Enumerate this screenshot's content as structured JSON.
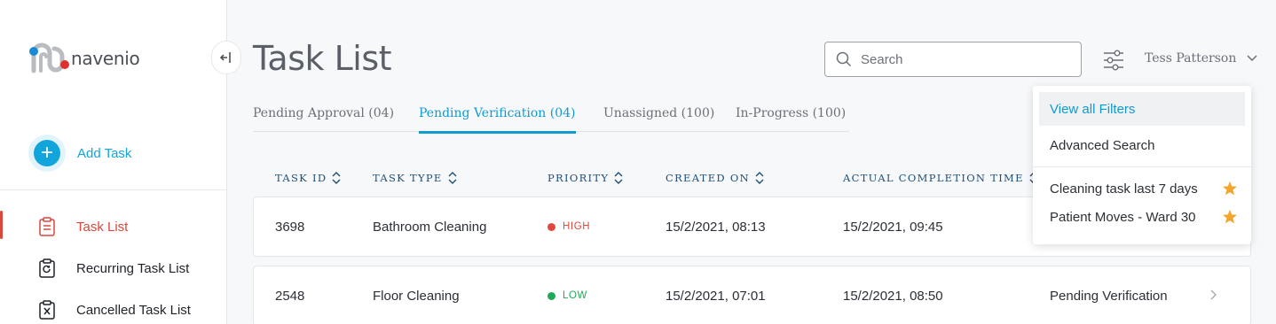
{
  "brand": {
    "name": "navenio"
  },
  "sidebar": {
    "add_task_label": "Add Task",
    "items": [
      {
        "label": "Task List",
        "icon": "clipboard-icon",
        "active": true
      },
      {
        "label": "Recurring Task List",
        "icon": "recurring-clipboard-icon",
        "active": false
      },
      {
        "label": "Cancelled Task List",
        "icon": "cancelled-clipboard-icon",
        "active": false
      }
    ]
  },
  "header": {
    "title": "Task List",
    "search_placeholder": "Search",
    "user_name": "Tess Patterson"
  },
  "tabs": [
    {
      "label": "Pending Approval (04)",
      "active": false
    },
    {
      "label": "Pending Verification (04)",
      "active": true
    },
    {
      "label": "Unassigned (100)",
      "active": false
    },
    {
      "label": "In-Progress (100)",
      "active": false
    }
  ],
  "table": {
    "columns": [
      "TASK ID",
      "TASK TYPE",
      "PRIORITY",
      "CREATED ON",
      "ACTUAL COMPLETION TIME"
    ],
    "rows": [
      {
        "task_id": "3698",
        "task_type": "Bathroom Cleaning",
        "priority": "HIGH",
        "created_on": "15/2/2021, 08:13",
        "completion_time": "15/2/2021, 09:45",
        "status": ""
      },
      {
        "task_id": "2548",
        "task_type": "Floor Cleaning",
        "priority": "LOW",
        "created_on": "15/2/2021, 07:01",
        "completion_time": "15/2/2021, 08:50",
        "status": "Pending Verification"
      }
    ]
  },
  "filter_menu": {
    "view_all": "View all Filters",
    "advanced_search": "Advanced Search",
    "saved": [
      "Cleaning task last 7 days",
      "Patient Moves - Ward 30"
    ]
  },
  "colors": {
    "accent": "#0f9bd0",
    "active_nav": "#d9473b",
    "priority_high": "#e0483d",
    "priority_low": "#1faa59",
    "star": "#f2a62b"
  }
}
